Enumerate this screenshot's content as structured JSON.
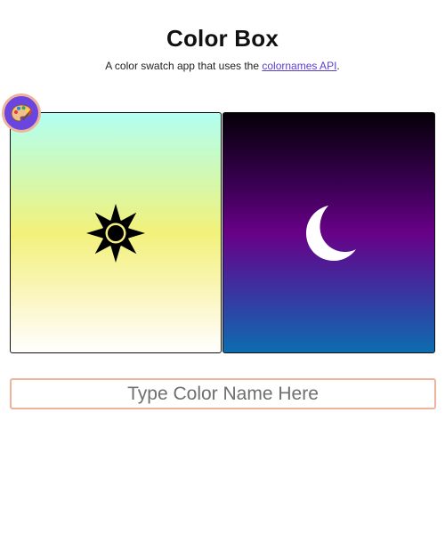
{
  "header": {
    "title": "Color Box",
    "subtitle_prefix": "A color swatch app that uses the ",
    "subtitle_link": "colornames API",
    "subtitle_suffix": "."
  },
  "palette_button": {
    "icon": "palette-icon",
    "color": "#6a45df",
    "border_color": "#efb29a"
  },
  "swatches": [
    {
      "name": "light",
      "icon": "sun-icon",
      "gradient": [
        "#b2fff2",
        "#f2f17a",
        "#ffffff"
      ]
    },
    {
      "name": "dark",
      "icon": "moon-icon",
      "gradient": [
        "#050007",
        "#680087",
        "#0d6cb0"
      ]
    }
  ],
  "search": {
    "placeholder": "Type Color Name Here",
    "value": ""
  }
}
